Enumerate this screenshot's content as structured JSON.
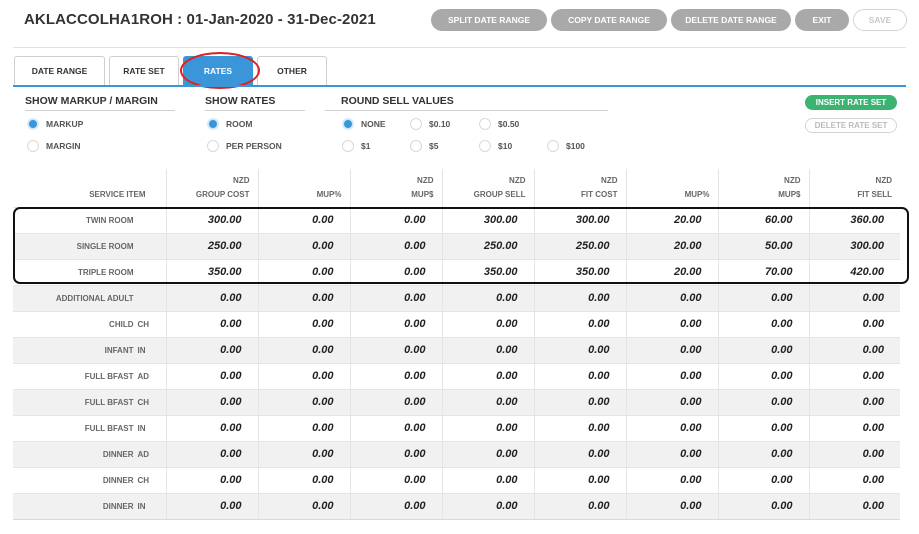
{
  "header": {
    "title": "AKLACCOLHA1ROH : 01-Jan-2020 - 31-Dec-2021"
  },
  "toolbar": {
    "split_label": "SPLIT DATE RANGE",
    "copy_label": "COPY DATE RANGE",
    "delete_label": "DELETE DATE RANGE",
    "exit_label": "EXIT",
    "save_label": "SAVE"
  },
  "tabs": [
    {
      "label": "DATE RANGE"
    },
    {
      "label": "RATE SET"
    },
    {
      "label": "RATES",
      "active": true
    },
    {
      "label": "OTHER"
    }
  ],
  "options": {
    "markup_group": {
      "title": "SHOW MARKUP / MARGIN",
      "items": [
        {
          "label": "MARKUP",
          "selected": true
        },
        {
          "label": "MARGIN",
          "selected": false
        }
      ]
    },
    "rates_group": {
      "title": "SHOW RATES",
      "items": [
        {
          "label": "ROOM",
          "selected": true
        },
        {
          "label": "PER PERSON",
          "selected": false
        }
      ]
    },
    "round_group": {
      "title": "ROUND SELL VALUES",
      "items": [
        {
          "label": "NONE",
          "selected": true
        },
        {
          "label": "$0.10"
        },
        {
          "label": "$0.50"
        },
        {
          "label": "$1"
        },
        {
          "label": "$5"
        },
        {
          "label": "$10"
        },
        {
          "label": "$100"
        }
      ]
    }
  },
  "actions": {
    "insert_label": "INSERT RATE SET",
    "delete_label": "DELETE RATE SET"
  },
  "table": {
    "headers": [
      {
        "top": "",
        "bottom": "SERVICE ITEM"
      },
      {
        "top": "NZD",
        "bottom": "GROUP COST"
      },
      {
        "top": "",
        "bottom": "MUP%"
      },
      {
        "top": "NZD",
        "bottom": "MUP$"
      },
      {
        "top": "NZD",
        "bottom": "GROUP SELL"
      },
      {
        "top": "NZD",
        "bottom": "FIT COST"
      },
      {
        "top": "",
        "bottom": "MUP%"
      },
      {
        "top": "NZD",
        "bottom": "MUP$"
      },
      {
        "top": "NZD",
        "bottom": "FIT SELL"
      }
    ],
    "rows": [
      {
        "name": "TWIN ROOM",
        "code": "",
        "values": [
          "300.00",
          "0.00",
          "0.00",
          "300.00",
          "300.00",
          "20.00",
          "60.00",
          "360.00"
        ]
      },
      {
        "name": "SINGLE ROOM",
        "code": "",
        "values": [
          "250.00",
          "0.00",
          "0.00",
          "250.00",
          "250.00",
          "20.00",
          "50.00",
          "300.00"
        ]
      },
      {
        "name": "TRIPLE ROOM",
        "code": "",
        "values": [
          "350.00",
          "0.00",
          "0.00",
          "350.00",
          "350.00",
          "20.00",
          "70.00",
          "420.00"
        ]
      },
      {
        "name": "ADDITIONAL ADULT",
        "code": "",
        "values": [
          "0.00",
          "0.00",
          "0.00",
          "0.00",
          "0.00",
          "0.00",
          "0.00",
          "0.00"
        ]
      },
      {
        "name": "CHILD",
        "code": "CH",
        "values": [
          "0.00",
          "0.00",
          "0.00",
          "0.00",
          "0.00",
          "0.00",
          "0.00",
          "0.00"
        ]
      },
      {
        "name": "INFANT",
        "code": "IN",
        "values": [
          "0.00",
          "0.00",
          "0.00",
          "0.00",
          "0.00",
          "0.00",
          "0.00",
          "0.00"
        ]
      },
      {
        "name": "FULL BFAST",
        "code": "AD",
        "values": [
          "0.00",
          "0.00",
          "0.00",
          "0.00",
          "0.00",
          "0.00",
          "0.00",
          "0.00"
        ]
      },
      {
        "name": "FULL BFAST",
        "code": "CH",
        "values": [
          "0.00",
          "0.00",
          "0.00",
          "0.00",
          "0.00",
          "0.00",
          "0.00",
          "0.00"
        ]
      },
      {
        "name": "FULL BFAST",
        "code": "IN",
        "values": [
          "0.00",
          "0.00",
          "0.00",
          "0.00",
          "0.00",
          "0.00",
          "0.00",
          "0.00"
        ]
      },
      {
        "name": "DINNER",
        "code": "AD",
        "values": [
          "0.00",
          "0.00",
          "0.00",
          "0.00",
          "0.00",
          "0.00",
          "0.00",
          "0.00"
        ]
      },
      {
        "name": "DINNER",
        "code": "CH",
        "values": [
          "0.00",
          "0.00",
          "0.00",
          "0.00",
          "0.00",
          "0.00",
          "0.00",
          "0.00"
        ]
      },
      {
        "name": "DINNER",
        "code": "IN",
        "values": [
          "0.00",
          "0.00",
          "0.00",
          "0.00",
          "0.00",
          "0.00",
          "0.00",
          "0.00"
        ]
      }
    ]
  }
}
